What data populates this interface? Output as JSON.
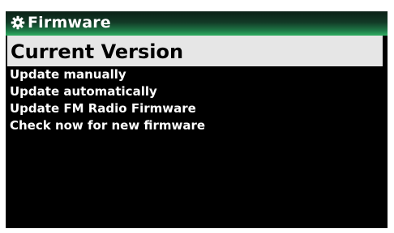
{
  "header": {
    "icon": "gear-icon",
    "title": "Firmware"
  },
  "menu": {
    "items": [
      {
        "label": "Current Version",
        "selected": true
      },
      {
        "label": "Update manually",
        "selected": false
      },
      {
        "label": "Update automatically",
        "selected": false
      },
      {
        "label": "Update FM Radio Firmware",
        "selected": false
      },
      {
        "label": "Check now for new firmware",
        "selected": false
      }
    ]
  },
  "colors": {
    "background": "#000000",
    "title_gradient_top": "#0b2016",
    "title_gradient_bottom": "#2fae62",
    "selection": "#e6e6e6",
    "text": "#ffffff"
  }
}
